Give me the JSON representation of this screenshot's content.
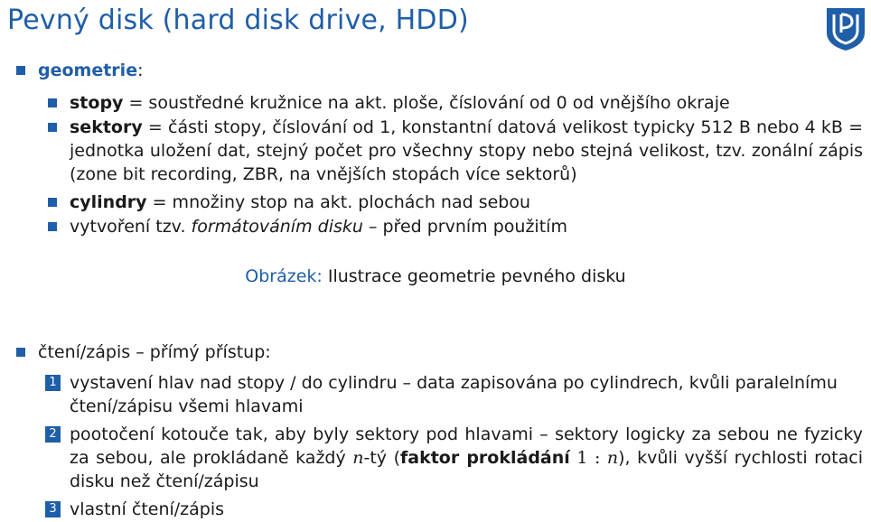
{
  "title": "Pevný disk (hard disk drive, HDD)",
  "geometry": {
    "heading": "geometrie",
    "colon": ":",
    "items": [
      {
        "term": "stopy",
        "text": " = soustředné kružnice na akt. ploše, číslování od 0 od vnějšího okraje"
      },
      {
        "term": "sektory",
        "text": " = části stopy, číslování od 1, konstantní datová velikost typicky 512 B nebo 4 kB = jednotka uložení dat, stejný počet pro všechny stopy nebo stejná velikost, tzv. zonální zápis (zone bit recording, ZBR, na vnějších stopách více sektorů)"
      },
      {
        "term": "cylindry",
        "text": " = množiny stop na akt. plochách nad sebou"
      },
      {
        "pre": "vytvoření tzv. ",
        "italic": "formátováním disku",
        "post": " – před prvním použitím"
      }
    ]
  },
  "figure_caption": {
    "label": "Obrázek:",
    "text": " Ilustrace geometrie pevného disku"
  },
  "access": {
    "heading": "čtení/zápis – přímý přístup:",
    "steps": [
      {
        "number": "1",
        "text": "vystavení hlav nad stopy / do cylindru – data zapisována po cylindrech, kvůli paralelnímu čtení/zápisu všemi hlavami"
      },
      {
        "number": "2",
        "pre": "pootočení kotouče tak, aby byly sektory pod hlavami – sektory logicky za sebou ne fyzicky za sebou, ale prokládaně každý ",
        "var_n": "n",
        "mid": "-tý (",
        "bold": "faktor prokládání",
        "ratio_left": " 1 : ",
        "ratio_n": "n",
        "post": "), kvůli vyšší rychlosti rotaci disku než čtení/zápisu"
      },
      {
        "number": "3",
        "text": "vlastní čtení/zápis"
      }
    ]
  },
  "colors": {
    "accent": "#1f5ea8",
    "text": "#1a1a1a",
    "background": "#ffffff"
  },
  "logo": {
    "icon": "university-shield-logo",
    "letters": "UP"
  }
}
